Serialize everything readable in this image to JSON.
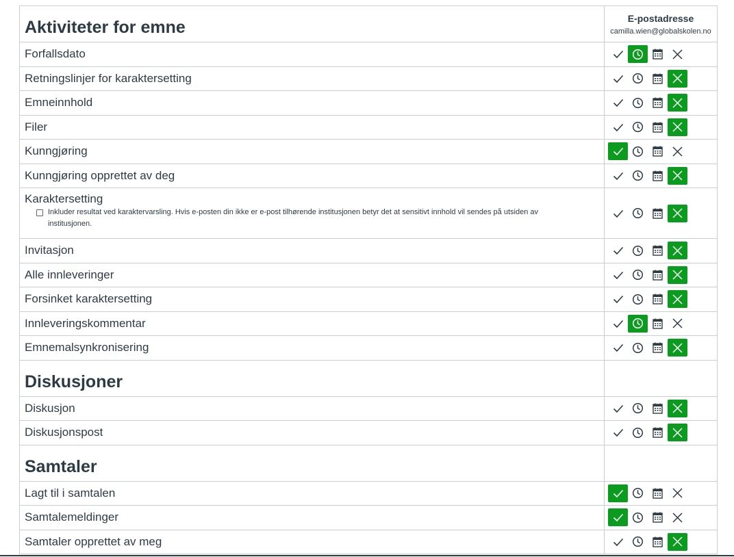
{
  "header": {
    "column_title": "E-postadresse",
    "column_email": "camilla.wien@globalskolen.no"
  },
  "colors": {
    "active": "#0b9b1f",
    "text": "#2d3b45",
    "border": "#c7cdd1"
  },
  "option_icons": [
    "checkmark-icon",
    "clock-icon",
    "calendar-icon",
    "x-icon"
  ],
  "sections": [
    {
      "title": "Aktiviteter for emne",
      "rows": [
        {
          "label": "Forfallsdato",
          "selected": "clock"
        },
        {
          "label": "Retningslinjer for karaktersetting",
          "selected": "never"
        },
        {
          "label": "Emneinnhold",
          "selected": "never"
        },
        {
          "label": "Filer",
          "selected": "never"
        },
        {
          "label": "Kunngjøring",
          "selected": "immediately"
        },
        {
          "label": "Kunngjøring opprettet av deg",
          "selected": "never"
        },
        {
          "label": "Karaktersetting",
          "selected": "never",
          "note": "Inkluder resultat ved karaktervarsling. Hvis e-posten din ikke er e-post tilhørende institusjonen betyr det at sensitivt innhold vil sendes på utsiden av institusjonen."
        },
        {
          "label": "Invitasjon",
          "selected": "never"
        },
        {
          "label": "Alle innleveringer",
          "selected": "never"
        },
        {
          "label": "Forsinket karaktersetting",
          "selected": "never"
        },
        {
          "label": "Innleveringskommentar",
          "selected": "clock"
        },
        {
          "label": "Emnemalsynkronisering",
          "selected": "never"
        }
      ]
    },
    {
      "title": "Diskusjoner",
      "rows": [
        {
          "label": "Diskusjon",
          "selected": "never"
        },
        {
          "label": "Diskusjonspost",
          "selected": "never"
        }
      ]
    },
    {
      "title": "Samtaler",
      "rows": [
        {
          "label": "Lagt til i samtalen",
          "selected": "immediately"
        },
        {
          "label": "Samtalemeldinger",
          "selected": "immediately"
        },
        {
          "label": "Samtaler opprettet av meg",
          "selected": "never"
        }
      ]
    }
  ]
}
